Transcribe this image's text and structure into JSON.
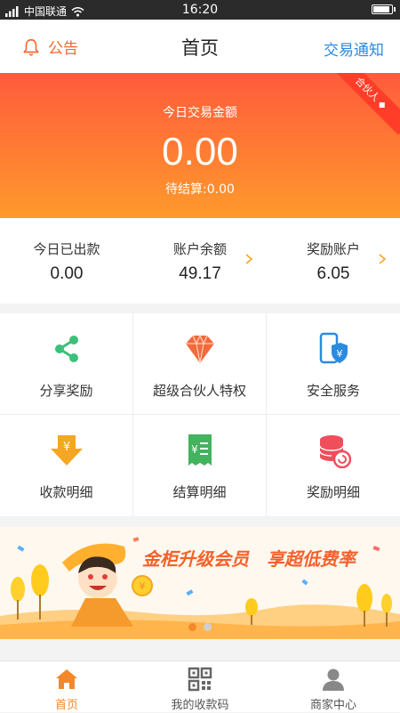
{
  "status_bar": {
    "carrier": "中国联通",
    "time": "16:20",
    "battery_level": 0.95
  },
  "header": {
    "notice_label": "公告",
    "title": "首页",
    "trade_notice_label": "交易通知"
  },
  "hero": {
    "label": "今日交易金额",
    "amount": "0.00",
    "pending": "待结算:0.00",
    "badge": "合伙人"
  },
  "stats": [
    {
      "label": "今日已出款",
      "value": "0.00",
      "arrow": false
    },
    {
      "label": "账户余额",
      "value": "49.17",
      "arrow": true
    },
    {
      "label": "奖励账户",
      "value": "6.05",
      "arrow": true
    }
  ],
  "grid": [
    {
      "label": "分享奖励",
      "icon": "share-icon"
    },
    {
      "label": "超级合伙人特权",
      "icon": "diamond-icon"
    },
    {
      "label": "安全服务",
      "icon": "phone-shield-icon"
    },
    {
      "label": "收款明细",
      "icon": "download-yen-icon"
    },
    {
      "label": "结算明细",
      "icon": "receipt-icon"
    },
    {
      "label": "奖励明细",
      "icon": "coin-stack-icon"
    }
  ],
  "banner": {
    "headline": "金柜升级会员　享超低费率",
    "active_slide": 0,
    "slide_count": 2
  },
  "tabs": [
    {
      "label": "首页",
      "icon": "home-icon",
      "active": true
    },
    {
      "label": "我的收款码",
      "icon": "qr-code-icon",
      "active": false
    },
    {
      "label": "商家中心",
      "icon": "user-icon",
      "active": false
    }
  ],
  "colors": {
    "accent": "#f5682e",
    "link": "#2c8be0",
    "tab_active": "#f5882a"
  }
}
